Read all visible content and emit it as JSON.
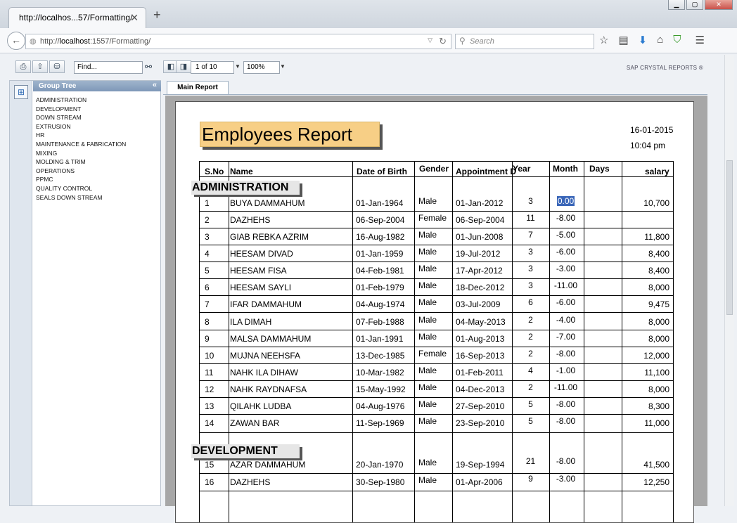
{
  "browser": {
    "tab_title": "http://localhos...57/Formatting/",
    "url_prefix": "http://",
    "url_host": "localhost",
    "url_rest": ":1557/Formatting/",
    "search_placeholder": "Search"
  },
  "toolbar": {
    "find_placeholder": "Find...",
    "page_indicator": "1 of 10",
    "zoom": "100%",
    "brand": "SAP CRYSTAL REPORTS ®"
  },
  "group_tree": {
    "title": "Group Tree",
    "items": [
      "ADMINISTRATION",
      "DEVELOPMENT",
      "DOWN STREAM",
      "EXTRUSION",
      "HR",
      "MAINTENANCE & FABRICATION",
      "MIXING",
      "MOLDING & TRIM",
      "OPERATIONS",
      "PPMC",
      "QUALITY CONTROL",
      "SEALS DOWN STREAM"
    ]
  },
  "report": {
    "tab_label": "Main Report",
    "title": "Employees Report",
    "date": "16-01-2015",
    "time": "10:04 pm",
    "columns": [
      "S.No",
      "Name",
      "Date of Birth",
      "Gender",
      "Appointment D",
      "Year",
      "Month",
      "Days",
      "salary"
    ],
    "groups": [
      {
        "name": "ADMINISTRATION",
        "rows": [
          [
            "1",
            "BUYA DAMMAHUM",
            "01-Jan-1964",
            "Male",
            "01-Jan-2012",
            "3",
            "0.00",
            "",
            "10,700"
          ],
          [
            "2",
            "DAZHEHS",
            "06-Sep-2004",
            "Female",
            "06-Sep-2004",
            "11",
            "-8.00",
            "",
            ""
          ],
          [
            "3",
            "GIAB REBKA AZRIM",
            "16-Aug-1982",
            "Male",
            "01-Jun-2008",
            "7",
            "-5.00",
            "",
            "11,800"
          ],
          [
            "4",
            "HEESAM DIVAD",
            "01-Jan-1959",
            "Male",
            "19-Jul-2012",
            "3",
            "-6.00",
            "",
            "8,400"
          ],
          [
            "5",
            "HEESAM FISA",
            "04-Feb-1981",
            "Male",
            "17-Apr-2012",
            "3",
            "-3.00",
            "",
            "8,400"
          ],
          [
            "6",
            "HEESAM SAYLI",
            "01-Feb-1979",
            "Male",
            "18-Dec-2012",
            "3",
            "-11.00",
            "",
            "8,000"
          ],
          [
            "7",
            "IFAR DAMMAHUM",
            "04-Aug-1974",
            "Male",
            "03-Jul-2009",
            "6",
            "-6.00",
            "",
            "9,475"
          ],
          [
            "8",
            "ILA DIMAH",
            "07-Feb-1988",
            "Male",
            "04-May-2013",
            "2",
            "-4.00",
            "",
            "8,000"
          ],
          [
            "9",
            "MALSA DAMMAHUM",
            "01-Jan-1991",
            "Male",
            "01-Aug-2013",
            "2",
            "-7.00",
            "",
            "8,000"
          ],
          [
            "10",
            "MUJNA NEEHSFA",
            "13-Dec-1985",
            "Female",
            "16-Sep-2013",
            "2",
            "-8.00",
            "",
            "12,000"
          ],
          [
            "11",
            "NAHK ILA DIHAW",
            "10-Mar-1982",
            "Male",
            "01-Feb-2011",
            "4",
            "-1.00",
            "",
            "11,100"
          ],
          [
            "12",
            "NAHK RAYDNAFSA",
            "15-May-1992",
            "Male",
            "04-Dec-2013",
            "2",
            "-11.00",
            "",
            "8,000"
          ],
          [
            "13",
            "QILAHK LUDBA",
            "04-Aug-1976",
            "Male",
            "27-Sep-2010",
            "5",
            "-8.00",
            "",
            "8,300"
          ],
          [
            "14",
            "ZAWAN BAR",
            "11-Sep-1969",
            "Male",
            "23-Sep-2010",
            "5",
            "-8.00",
            "",
            "11,000"
          ]
        ]
      },
      {
        "name": "DEVELOPMENT",
        "rows": [
          [
            "15",
            "AZAR DAMMAHUM",
            "20-Jan-1970",
            "Male",
            "19-Sep-1994",
            "21",
            "-8.00",
            "",
            "41,500"
          ],
          [
            "16",
            "DAZHEHS",
            "30-Sep-1980",
            "Male",
            "01-Apr-2006",
            "9",
            "-3.00",
            "",
            "12,250"
          ]
        ]
      }
    ]
  }
}
